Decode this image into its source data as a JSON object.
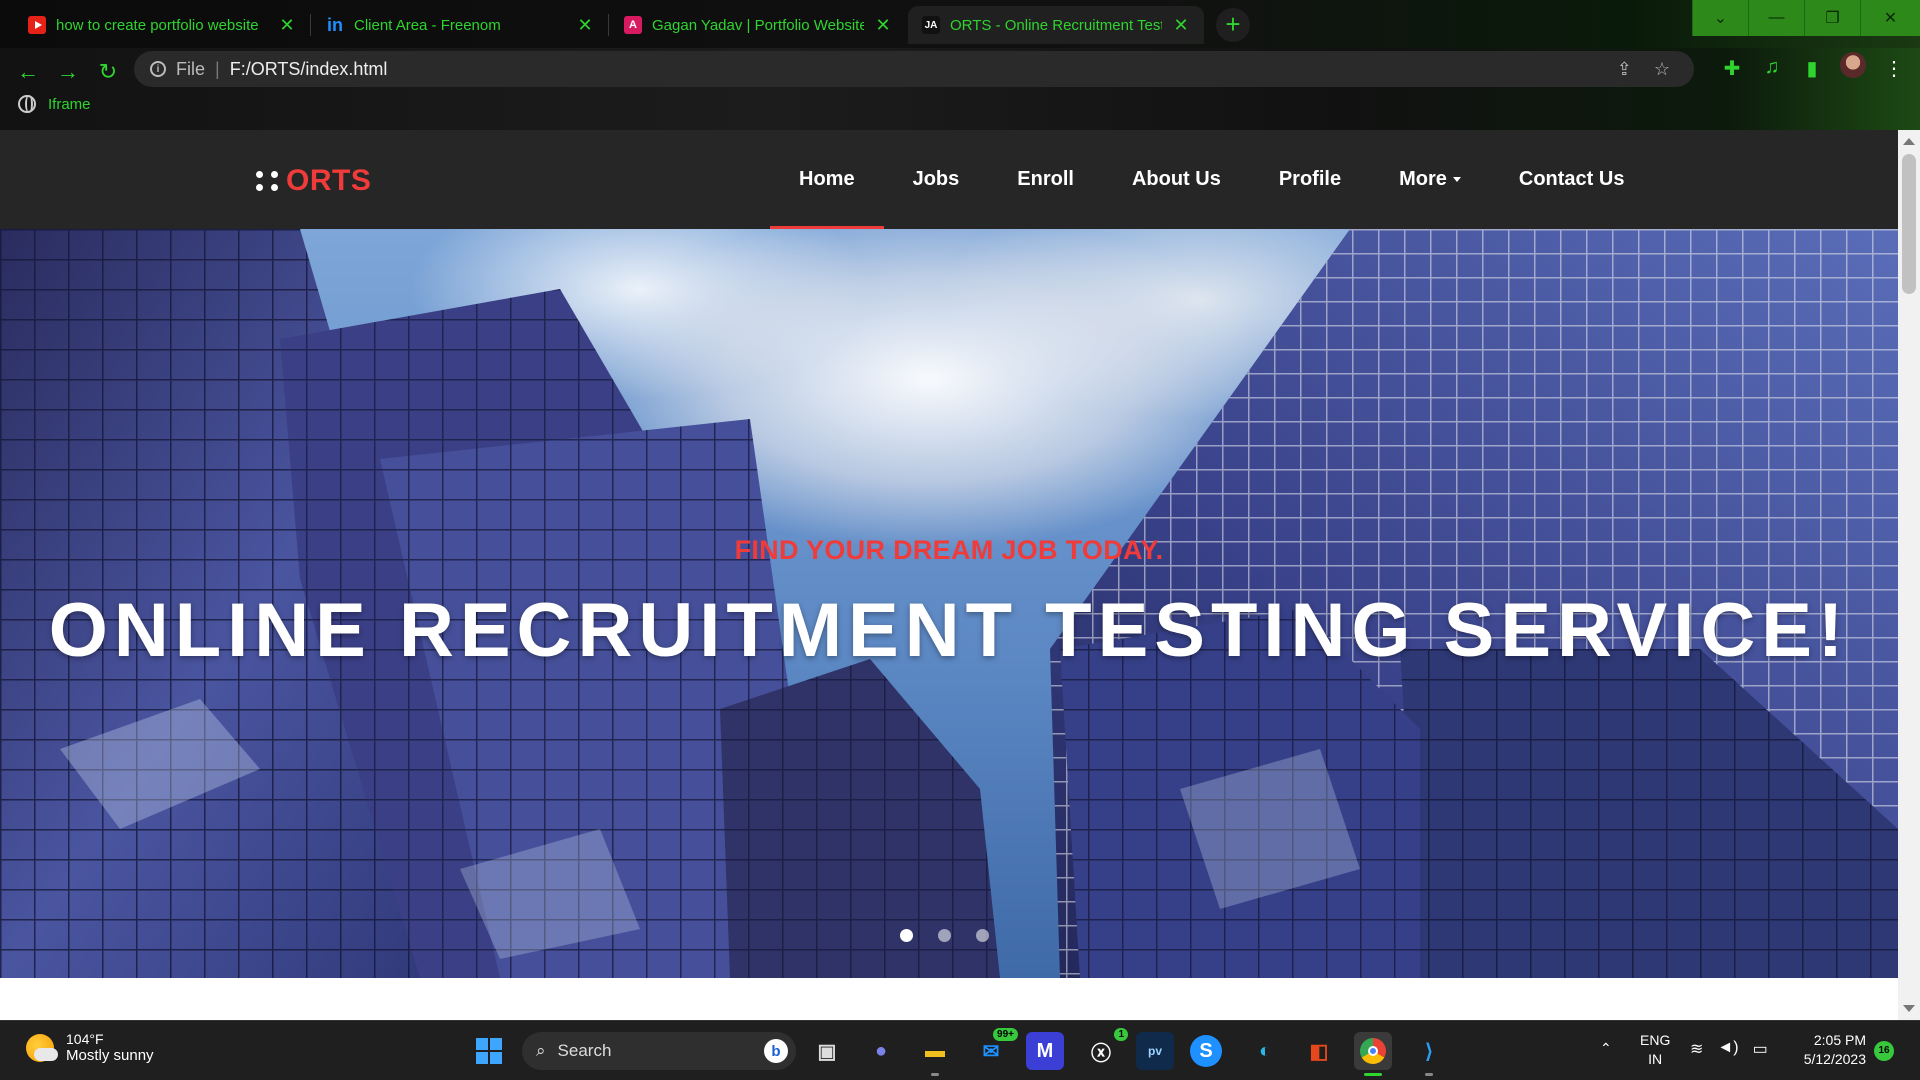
{
  "browser": {
    "tabs": [
      {
        "title": "how to create portfolio website",
        "favicon": "youtube-icon"
      },
      {
        "title": "Client Area - Freenom",
        "favicon": "freenom-icon"
      },
      {
        "title": "Gagan Yadav | Portfolio Website |",
        "favicon": "portfolio-a-icon"
      },
      {
        "title": "ORTS - Online Recruitment Testin",
        "favicon": "ja-icon",
        "active": true
      }
    ],
    "favicon_letters": {
      "portfolio": "A",
      "ja": "JA",
      "freenom": "in"
    },
    "url_scheme": "File",
    "url": "F:/ORTS/index.html",
    "bookmark": "Iframe",
    "theme_accent": "#2fd42f"
  },
  "site": {
    "brand": "ORTS",
    "brand_color": "#f03b3b",
    "nav": [
      {
        "label": "Home",
        "active": true
      },
      {
        "label": "Jobs"
      },
      {
        "label": "Enroll"
      },
      {
        "label": "About Us"
      },
      {
        "label": "Profile"
      },
      {
        "label": "More",
        "dropdown": true
      },
      {
        "label": "Contact Us"
      }
    ],
    "hero": {
      "subtitle": "FIND YOUR DREAM JOB TODAY.",
      "title": "ONLINE RECRUITMENT TESTING SERVICE!",
      "slides": 3,
      "active_slide": 1
    }
  },
  "taskbar": {
    "weather_temp": "104°F",
    "weather_desc": "Mostly sunny",
    "search_label": "Search",
    "mail_badge": "99+",
    "xbox_badge": "1",
    "language": "ENG",
    "region": "IN",
    "time": "2:05 PM",
    "date": "5/12/2023",
    "notification_count": "16"
  }
}
